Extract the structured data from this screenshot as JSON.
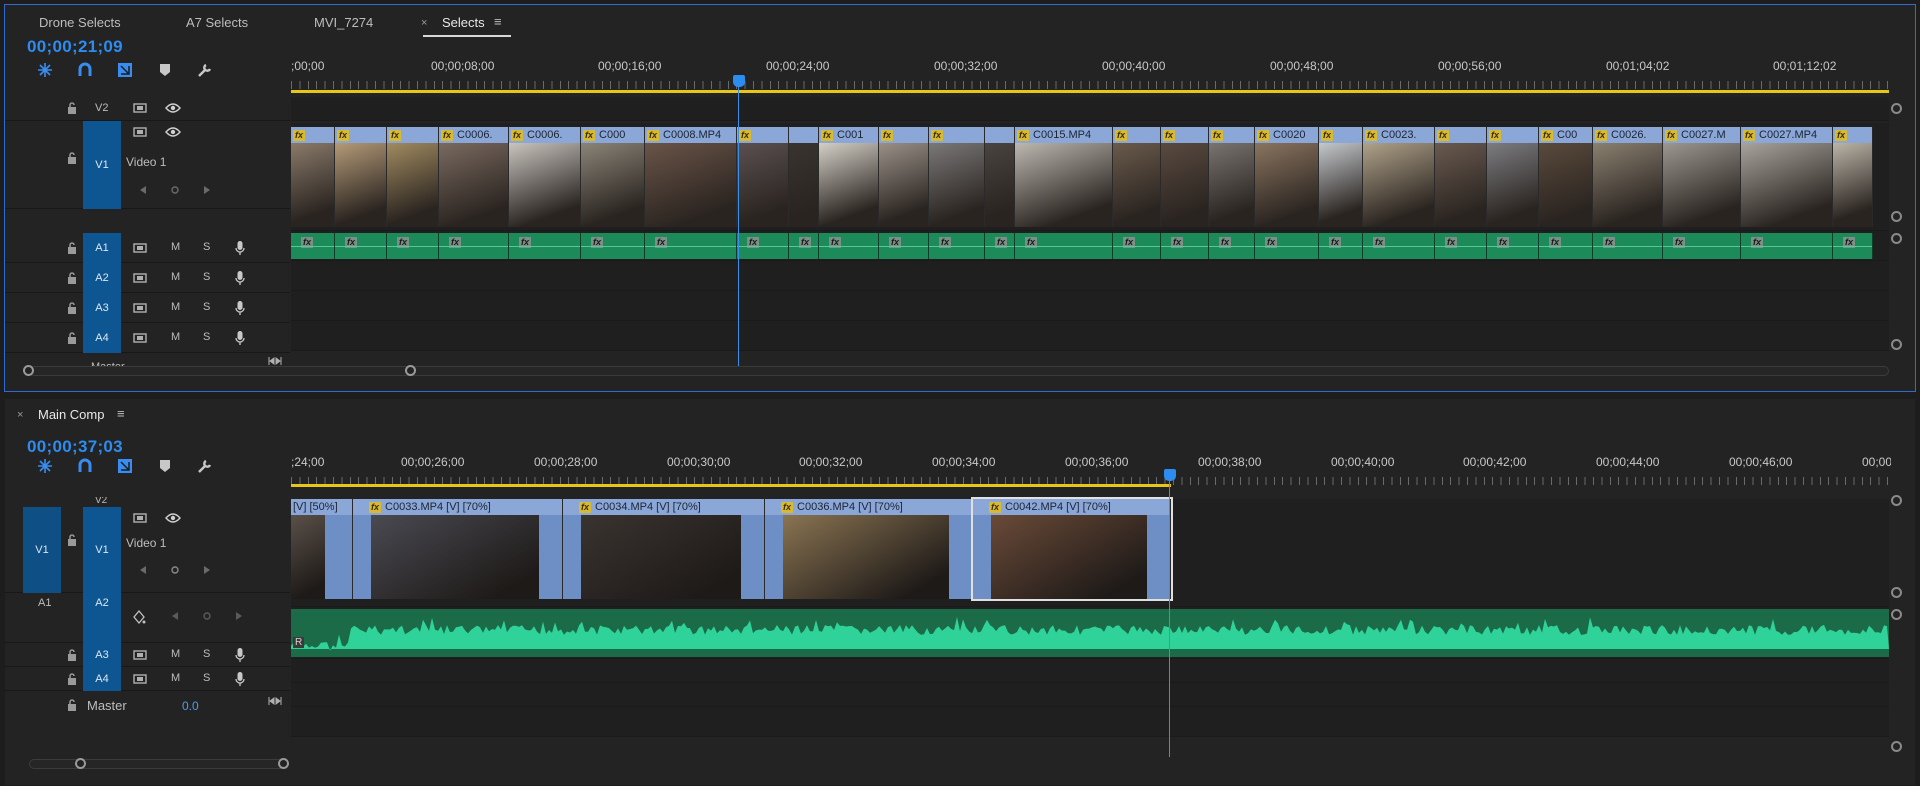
{
  "top_panel": {
    "tabs": [
      {
        "label": "Drone Selects",
        "active": false
      },
      {
        "label": "A7 Selects",
        "active": false
      },
      {
        "label": "MVI_7274",
        "active": false
      },
      {
        "label": "Selects",
        "active": true
      }
    ],
    "close_glyph": "×",
    "menu_glyph": "≡",
    "timecode": "00;00;21;09",
    "ruler_labels": [
      ";00;00",
      "00;00;08;00",
      "00;00;16;00",
      "00;00;24;00",
      "00;00;32;00",
      "00;00;40;00",
      "00;00;48;00",
      "00;00;56;00",
      "00;01;04;02",
      "00;01;12;02"
    ],
    "tracks": {
      "v2": {
        "label": "V2"
      },
      "v1": {
        "label": "V1",
        "name": "Video 1"
      },
      "audio": [
        {
          "label": "A1",
          "m": "M",
          "s": "S"
        },
        {
          "label": "A2",
          "m": "M",
          "s": "S"
        },
        {
          "label": "A3",
          "m": "M",
          "s": "S"
        },
        {
          "label": "A4",
          "m": "M",
          "s": "S"
        }
      ],
      "master_partial": "Master"
    },
    "video_clips": [
      {
        "label": "",
        "fx": true
      },
      {
        "label": "",
        "fx": true
      },
      {
        "label": "",
        "fx": true
      },
      {
        "label": "C0006.",
        "fx": true
      },
      {
        "label": "C0006.",
        "fx": true
      },
      {
        "label": "C000",
        "fx": true
      },
      {
        "label": "C0008.MP4",
        "fx": true
      },
      {
        "label": "",
        "fx": true
      },
      {
        "label": "",
        "fx": false
      },
      {
        "label": "C001",
        "fx": true
      },
      {
        "label": "",
        "fx": true
      },
      {
        "label": "",
        "fx": true
      },
      {
        "label": "",
        "fx": false
      },
      {
        "label": "C0015.MP4",
        "fx": true
      },
      {
        "label": "",
        "fx": true
      },
      {
        "label": "",
        "fx": true
      },
      {
        "label": "",
        "fx": true
      },
      {
        "label": "C0020",
        "fx": true
      },
      {
        "label": "",
        "fx": true
      },
      {
        "label": "C0023.",
        "fx": true
      },
      {
        "label": "",
        "fx": true
      },
      {
        "label": "",
        "fx": true
      },
      {
        "label": "C00",
        "fx": true
      },
      {
        "label": "C0026.",
        "fx": true
      },
      {
        "label": "C0027.M",
        "fx": true
      },
      {
        "label": "C0027.MP4",
        "fx": true
      },
      {
        "label": "",
        "fx": true
      }
    ]
  },
  "bottom_panel": {
    "tab": "Main Comp",
    "close_glyph": "×",
    "menu_glyph": "≡",
    "timecode": "00;00;37;03",
    "ruler_labels": [
      ";24;00",
      "00;00;26;00",
      "00;00;28;00",
      "00;00;30;00",
      "00;00;32;00",
      "00;00;34;00",
      "00;00;36;00",
      "00;00;38;00",
      "00;00;40;00",
      "00;00;42;00",
      "00;00;44;00",
      "00;00;46;00",
      "00;00("
    ],
    "tracks": {
      "v2_partial": "V2",
      "v1_source": "V1",
      "v1": {
        "label": "V1",
        "name": "Video 1"
      },
      "a1_source": "A1",
      "a2": {
        "label": "A2"
      },
      "a3": {
        "label": "A3",
        "m": "M",
        "s": "S"
      },
      "a4": {
        "label": "A4",
        "m": "M",
        "s": "S"
      },
      "master": {
        "label": "Master",
        "value": "0.0"
      }
    },
    "video_clips": [
      {
        "label": "[V] [50%]",
        "fx": false
      },
      {
        "label": "C0033.MP4 [V] [70%]",
        "fx": true
      },
      {
        "label": "C0034.MP4 [V] [70%]",
        "fx": true
      },
      {
        "label": "C0036.MP4 [V] [70%]",
        "fx": true
      },
      {
        "label": "C0042.MP4 [V] [70%]",
        "fx": true
      }
    ],
    "audio_badge": "R"
  },
  "colors": {
    "accent_blue": "#2d8cf0",
    "track_target": "#0e5691",
    "clip_video": "#8aa7d8",
    "clip_audio": "#1d8a5a",
    "waveform": "#2fd39a",
    "work_area": "#e6c619",
    "fx_badge": "#d8b932"
  },
  "icons": [
    "snap-icon",
    "magnet-icon",
    "linked-selection-icon",
    "marker-icon",
    "wrench-icon",
    "lock-icon",
    "eye-icon",
    "toggle-sync-icon",
    "mic-icon",
    "keyframe-icon"
  ]
}
